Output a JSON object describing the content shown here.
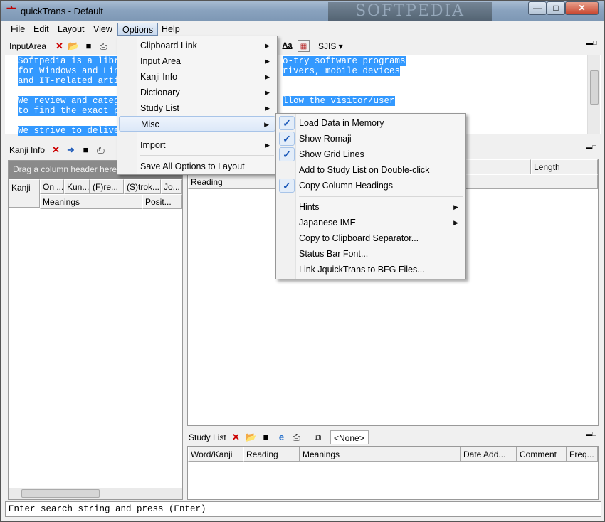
{
  "window": {
    "title": "quickTrans - Default",
    "app_icon": "kanji-app-icon",
    "watermark": "SOFTPEDIA",
    "controls": [
      "minimize",
      "maximize",
      "close"
    ]
  },
  "menubar": [
    "File",
    "Edit",
    "Layout",
    "View",
    "Options",
    "Help"
  ],
  "input_area": {
    "label": "InputArea",
    "encoding": "SJIS",
    "lines": [
      "Softpedia is a libra",
      "for Windows and Linu",
      "and IT-related artic",
      "",
      "We review and catego",
      "to find the exact pro",
      "",
      "We strive to deliver"
    ],
    "lines_right": [
      "o-try software programs",
      "rivers, mobile devices",
      "",
      "",
      "llow the visitor/user",
      "",
      "",
      ""
    ]
  },
  "kanji_info": {
    "label": "Kanji Info",
    "group_hint": "Drag a column header here",
    "headers_row1": [
      "Kanji",
      "On ...",
      "Kun...",
      "(F)re...",
      "(S)trok...",
      "Jo..."
    ],
    "headers_row2": [
      "Meanings",
      "Posit..."
    ]
  },
  "dictionary": {
    "headers_row1": [
      "Length"
    ],
    "headers_row2": [
      "Reading"
    ]
  },
  "study_list": {
    "label": "Study List",
    "dropdown": "<None>",
    "headers": [
      "Word/Kanji",
      "Reading",
      "Meanings",
      "Date Add...",
      "Comment",
      "Freq..."
    ]
  },
  "status_bar": "Enter search string and press (Enter)",
  "options_menu": {
    "items": [
      {
        "label": "Clipboard Link",
        "submenu": true
      },
      {
        "label": "Input Area",
        "submenu": true
      },
      {
        "label": "Kanji Info",
        "submenu": true
      },
      {
        "label": "Dictionary",
        "submenu": true
      },
      {
        "label": "Study List",
        "submenu": true
      },
      {
        "label": "Misc",
        "submenu": true
      },
      {
        "label": "Import",
        "submenu": true
      },
      {
        "label": "Save All Options to Layout",
        "submenu": false
      }
    ]
  },
  "misc_menu": {
    "items": [
      {
        "label": "Load Data in Memory",
        "checked": true
      },
      {
        "label": "Show Romaji",
        "checked": true
      },
      {
        "label": "Show Grid Lines",
        "checked": true
      },
      {
        "label": "Add to Study List on Double-click",
        "checked": false
      },
      {
        "label": "Copy Column Headings",
        "checked": true
      },
      {
        "label": "Hints",
        "submenu": true
      },
      {
        "label": "Japanese IME",
        "submenu": true
      },
      {
        "label": "Copy to Clipboard Separator...",
        "submenu": false
      },
      {
        "label": "Status Bar Font...",
        "submenu": false
      },
      {
        "label": "Link JquickTrans to BFG Files...",
        "submenu": false
      }
    ]
  },
  "colors": {
    "selection": "#3399ff",
    "check": "#1a58b8",
    "close_button": "#c8452e"
  }
}
